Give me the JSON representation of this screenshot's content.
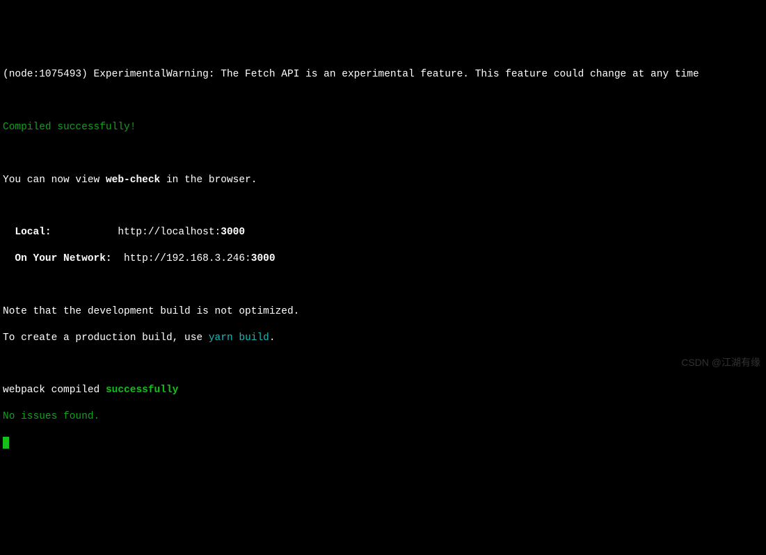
{
  "lines": {
    "warning": "(node:1075493) ExperimentalWarning: The Fetch API is an experimental feature. This feature could change at any time",
    "compiled": "Compiled successfully!",
    "view_prefix": "You can now view ",
    "app_name": "web-check",
    "view_suffix": " in the browser.",
    "local_label": "  Local:           ",
    "local_url_prefix": "http://localhost:",
    "local_port": "3000",
    "network_label": "  On Your Network:  ",
    "network_url_prefix": "http://192.168.3.246:",
    "network_port": "3000",
    "note1": "Note that the development build is not optimized.",
    "note2_prefix": "To create a production build, use ",
    "note2_cmd": "yarn build",
    "note2_suffix": ".",
    "webpack_prefix": "webpack compiled ",
    "webpack_status": "successfully",
    "issues": "No issues found."
  },
  "watermark": "CSDN @江湖有缘"
}
